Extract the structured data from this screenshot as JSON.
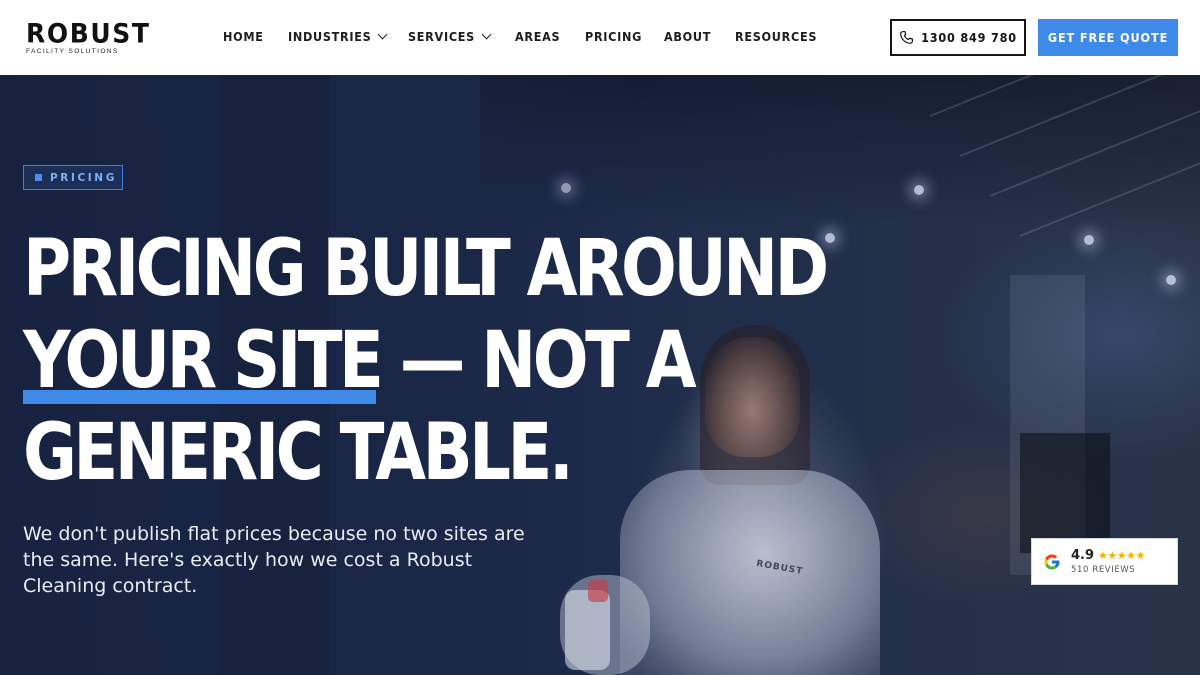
{
  "brand": {
    "name": "ROBUST",
    "tagline": "FACILITY SOLUTIONS"
  },
  "nav": {
    "items": [
      {
        "label": "HOME",
        "dropdown": false
      },
      {
        "label": "INDUSTRIES",
        "dropdown": true
      },
      {
        "label": "SERVICES",
        "dropdown": true
      },
      {
        "label": "AREAS",
        "dropdown": false
      },
      {
        "label": "PRICING",
        "dropdown": false
      },
      {
        "label": "ABOUT",
        "dropdown": false
      },
      {
        "label": "RESOURCES",
        "dropdown": false
      }
    ],
    "phone": "1300 849 780",
    "cta": "GET FREE QUOTE"
  },
  "hero": {
    "badge": "PRICING",
    "headline": {
      "line1": "PRICING BUILT AROUND",
      "line2_highlight": "YOUR SITE",
      "line2_rest": " — NOT A",
      "line3": "GENERIC TABLE."
    },
    "subtext": "We don't publish flat prices because no two sites are the same. Here's exactly how we cost a Robust Cleaning contract.",
    "shirt_logo": "ROBUST"
  },
  "review": {
    "icon": "google-icon",
    "rating": "4.9",
    "stars": 5,
    "count_label": "510 REVIEWS"
  },
  "colors": {
    "accent": "#3f8ae9",
    "hero_overlay": "#1c2a4d",
    "star": "#f5b301"
  }
}
